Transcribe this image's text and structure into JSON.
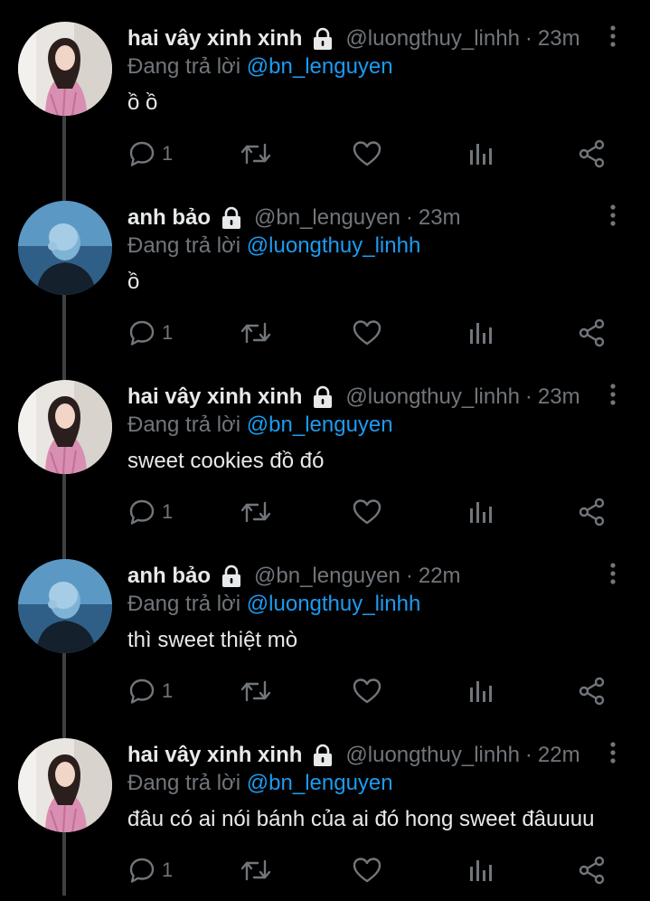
{
  "colors": {
    "background": "#000000",
    "text": "#e7e9ea",
    "muted": "#71767b",
    "mention": "#1d9bf0",
    "thread_line": "#3d4144"
  },
  "reply_prefix": "Đang trả lời",
  "tweets": [
    {
      "name": "hai vây xinh xinh",
      "handle": "@luongthuy_linhh",
      "time": "23m",
      "reply_to": "@bn_lenguyen",
      "text": "ồ ồ",
      "reply_count": "1",
      "avatar": "avatar-girl-pink"
    },
    {
      "name": "anh bảo",
      "handle": "@bn_lenguyen",
      "time": "23m",
      "reply_to": "@luongthuy_linhh",
      "text": "ồ",
      "reply_count": "1",
      "avatar": "avatar-blue-ocean"
    },
    {
      "name": "hai vây xinh xinh",
      "handle": "@luongthuy_linhh",
      "time": "23m",
      "reply_to": "@bn_lenguyen",
      "text": "sweet cookies đồ đó",
      "reply_count": "1",
      "avatar": "avatar-girl-pink"
    },
    {
      "name": "anh bảo",
      "handle": "@bn_lenguyen",
      "time": "22m",
      "reply_to": "@luongthuy_linhh",
      "text": "thì sweet thiệt mò",
      "reply_count": "1",
      "avatar": "avatar-blue-ocean"
    },
    {
      "name": "hai vây xinh xinh",
      "handle": "@luongthuy_linhh",
      "time": "22m",
      "reply_to": "@bn_lenguyen",
      "text": "đâu có ai nói bánh của ai đó hong sweet đâuuuu",
      "reply_count": "1",
      "avatar": "avatar-girl-pink"
    }
  ],
  "icons": {
    "lock": "lock-icon",
    "reply": "reply-icon",
    "retweet": "retweet-icon",
    "like": "heart-icon",
    "views": "analytics-icon",
    "share": "share-icon",
    "more": "more-vertical-icon"
  }
}
